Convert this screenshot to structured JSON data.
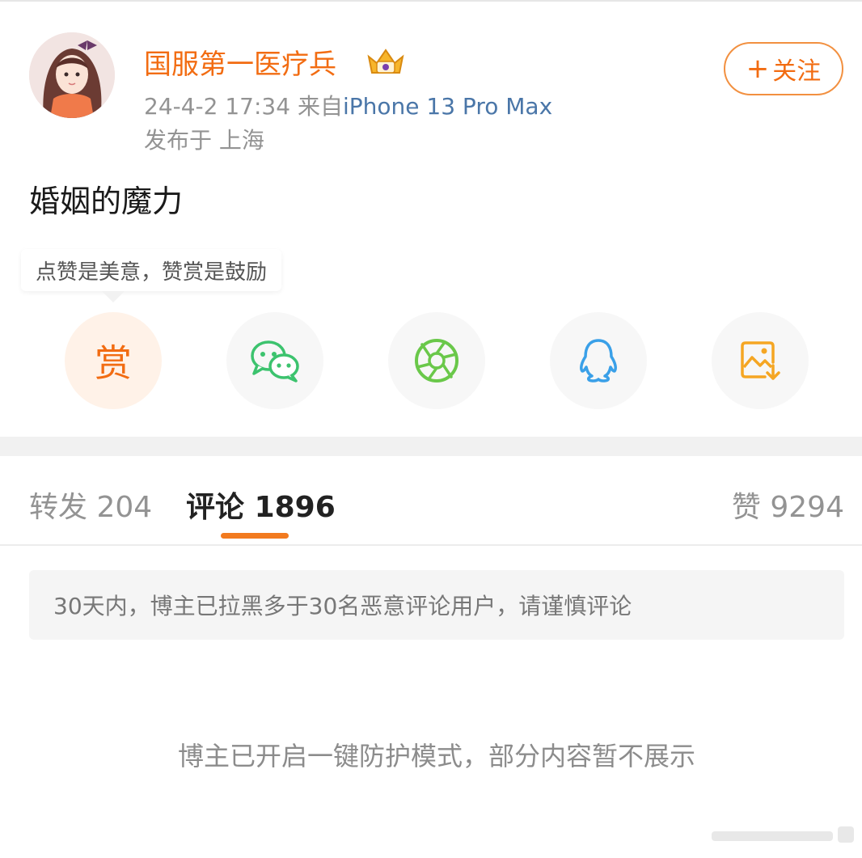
{
  "post": {
    "author_name": "国服第一医疗兵",
    "timestamp": "24-4-2 17:34",
    "source_prefix": "来自",
    "source_device": "iPhone 13 Pro Max",
    "location": "发布于 上海",
    "follow_plus": "+",
    "follow_label": "关注",
    "text": "婚姻的魔力"
  },
  "reward": {
    "tooltip": "点赞是美意，赞赏是鼓励",
    "button_label": "赏"
  },
  "share": {
    "icons": [
      "reward-icon",
      "wechat-icon",
      "moments-icon",
      "qq-icon",
      "save-image-icon"
    ]
  },
  "tabs": {
    "repost_label": "转发",
    "repost_count": "204",
    "comment_label": "评论",
    "comment_count": "1896",
    "like_label": "赞",
    "like_count": "9294"
  },
  "notice": "30天内，博主已拉黑多于30名恶意评论用户，请谨慎评论",
  "protection_message": "博主已开启一键防护模式，部分内容暂不展示",
  "colors": {
    "accent": "#f26c12",
    "link": "#4a76a8",
    "wechat": "#3cc36e",
    "moments": "#6ac84a",
    "qq": "#3aa0e8",
    "save": "#f5a623"
  }
}
